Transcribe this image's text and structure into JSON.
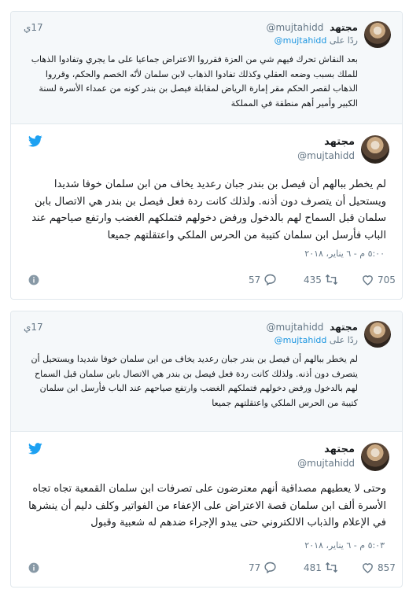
{
  "threads": [
    {
      "quoted": {
        "name": "مجتهد",
        "handle": "@mujtahidd",
        "time": "17ي",
        "replying_prefix": "ردًا على",
        "replying_handle": "@mujtahidd",
        "text": "بعد النقاش تحرك فيهم شي من العزة فقرروا الاعتراض جماعيا على ما يجري وتفادوا الذهاب للملك بسبب وضعه العقلي وكذلك تفادوا الذهاب لابن سلمان لأنّه الخصم والحكم، وقرروا الذهاب لقصر الحكم مقر إمارة الرياض لمقابلة فيصل بن بندر كونه من عمداء الأسرة لسنة الكبير وأمير أهم منطقة في المملكة"
      },
      "main": {
        "name": "مجتهد",
        "handle": "@mujtahidd",
        "text": "لم يخطر ببالهم أن فيصل بن بندر جبان رعديد يخاف من ابن سلمان خوفا شديدا ويستحيل أن يتصرف دون أذنه. ولذلك كانت ردة فعل فيصل بن بندر هي الاتصال بابن سلمان قبل السماح لهم بالدخول ورفض دخولهم فتملكهم الغضب وارتفع صياحهم عند الباب فأرسل ابن سلمان كتيبة من الحرس الملكي واعتقلتهم جميعا",
        "date": "٥:٠٠ م - ٦ يناير، ٢٠١٨",
        "likes": "705",
        "retweets": "435",
        "replies": "57"
      }
    },
    {
      "quoted": {
        "name": "مجتهد",
        "handle": "@mujtahidd",
        "time": "17ي",
        "replying_prefix": "ردًا على",
        "replying_handle": "@mujtahidd",
        "text": "لم يخطر ببالهم أن فيصل بن بندر جبان رعديد يخاف من ابن سلمان خوفا شديدا ويستحيل أن يتصرف دون أذنه. ولذلك كانت ردة فعل فيصل بن بندر هي الاتصال بابن سلمان قبل السماح لهم بالدخول ورفض دخولهم فتملكهم الغضب وارتفع صياحهم عند الباب فأرسل ابن سلمان كتيبة من الحرس الملكي واعتقلتهم جميعا"
      },
      "main": {
        "name": "مجتهد",
        "handle": "@mujtahidd",
        "text": "وحتى لا يعطيهم مصداقية أنهم معترضون على تصرفات ابن سلمان القمعية تجاه تجاه الأسرة ألف ابن سلمان قصة الاعتراض على الإعفاء من الفواتير وكلف دليم أن ينشرها في الإعلام والذباب الالكتروني حتى يبدو الإجراء ضدهم له شعبية وقبول",
        "date": "٥:٠٣ م - ٦ يناير، ٢٠١٨",
        "likes": "857",
        "retweets": "481",
        "replies": "77"
      }
    }
  ],
  "icons": {
    "brand": "twitter-bird-icon",
    "info": "info-icon",
    "like": "heart-icon",
    "retweet": "retweet-icon",
    "reply": "reply-icon"
  },
  "colors": {
    "twitter_blue": "#1da1f2",
    "link_blue": "#1b95e0",
    "muted": "#657786",
    "border": "#e1e8ed",
    "quote_bg": "#f5f8fa"
  }
}
